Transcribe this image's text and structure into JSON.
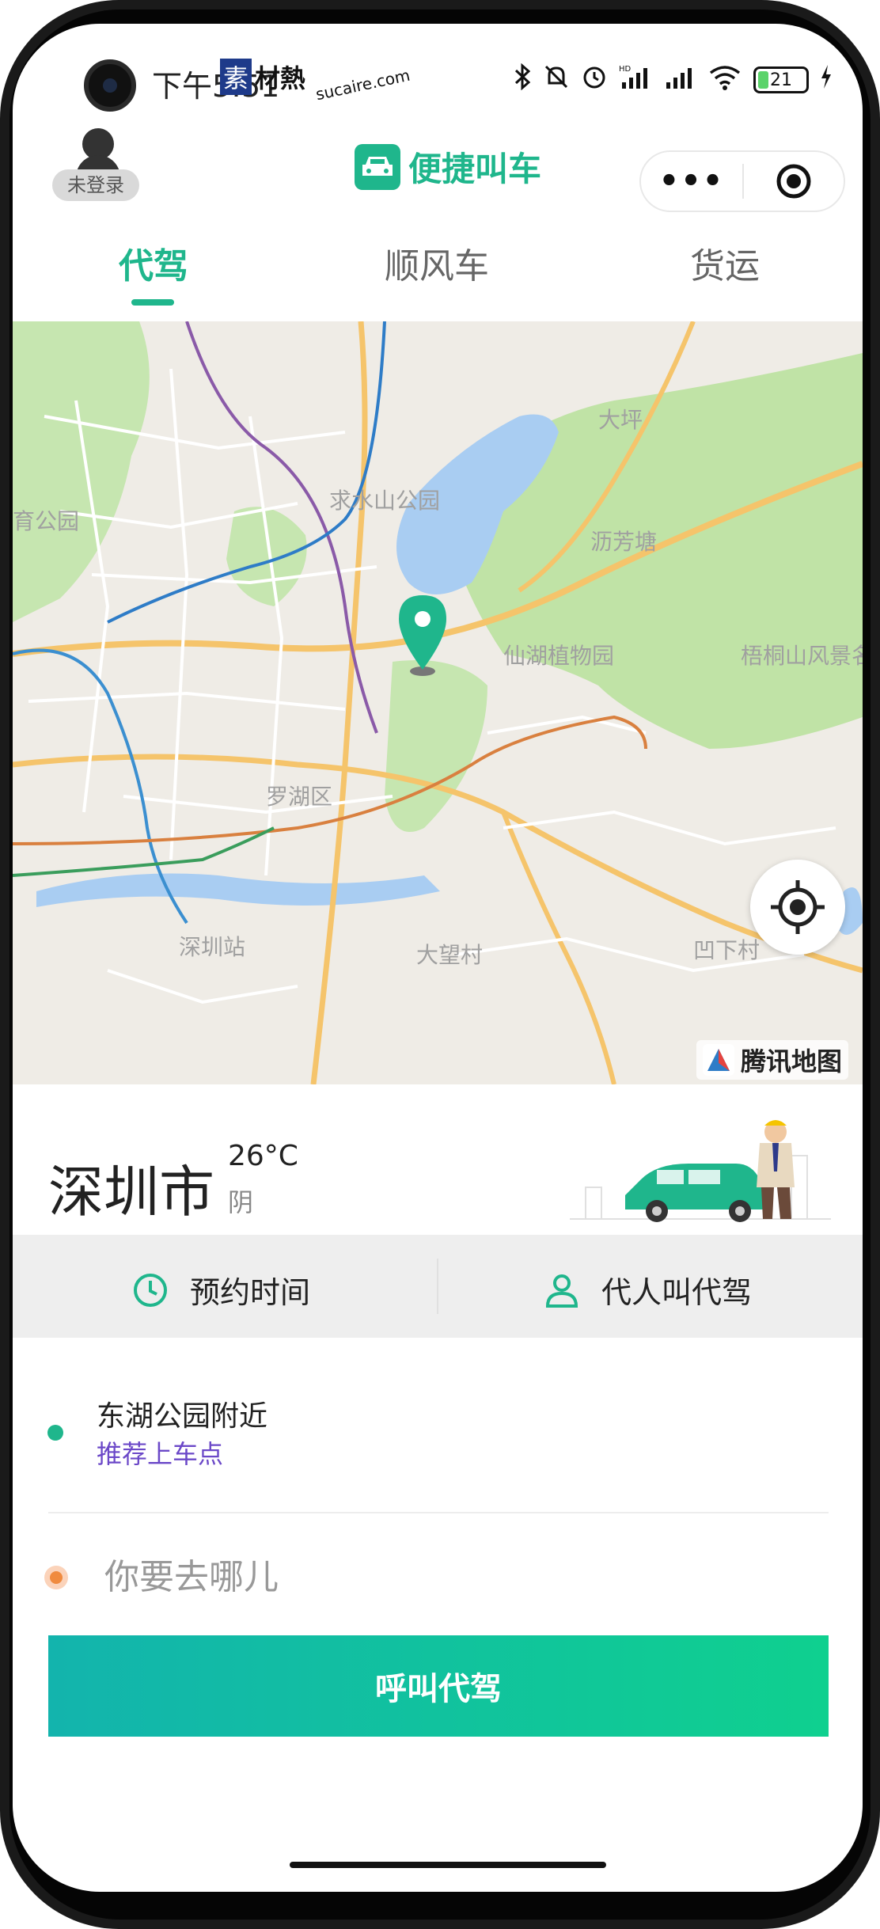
{
  "status_bar": {
    "time": "下午5:51",
    "battery": "21",
    "signal_label": "HD"
  },
  "watermark": {
    "char1": "素",
    "chars": "材熱",
    "site": "sucaire.com"
  },
  "header": {
    "user_label": "未登录",
    "app_title": "便捷叫车",
    "more_label": "•••"
  },
  "tabs": [
    {
      "label": "代驾",
      "active": true
    },
    {
      "label": "顺风车",
      "active": false
    },
    {
      "label": "货运",
      "active": false
    }
  ],
  "map": {
    "labels": {
      "park1": "求水山公园",
      "park2": "仙湖植物园",
      "park3": "梧桐山风景名胜区",
      "area1": "罗湖区",
      "area2": "深圳站",
      "area3": "大望村",
      "area4": "沥芳塘",
      "area5": "育公园",
      "area6": "凹下村",
      "area7": "大坪"
    },
    "brand": "腾讯地图",
    "colors": {
      "water": "#a9cdf2",
      "green": "#bfe3a8",
      "road_major": "#f5c46b",
      "pin": "#1fb68c"
    }
  },
  "weather": {
    "city": "深圳市",
    "temperature": "26°C",
    "condition": "阴"
  },
  "options": {
    "schedule": "预约时间",
    "proxy": "代人叫代驾"
  },
  "ride": {
    "pickup": "东湖公园附近",
    "pickup_hint": "推荐上车点",
    "destination_placeholder": "你要去哪儿",
    "call_button": "呼叫代驾"
  },
  "colors": {
    "accent": "#1fb68c",
    "hint_purple": "#6b48c8",
    "dest_orange": "#f08b3f"
  }
}
